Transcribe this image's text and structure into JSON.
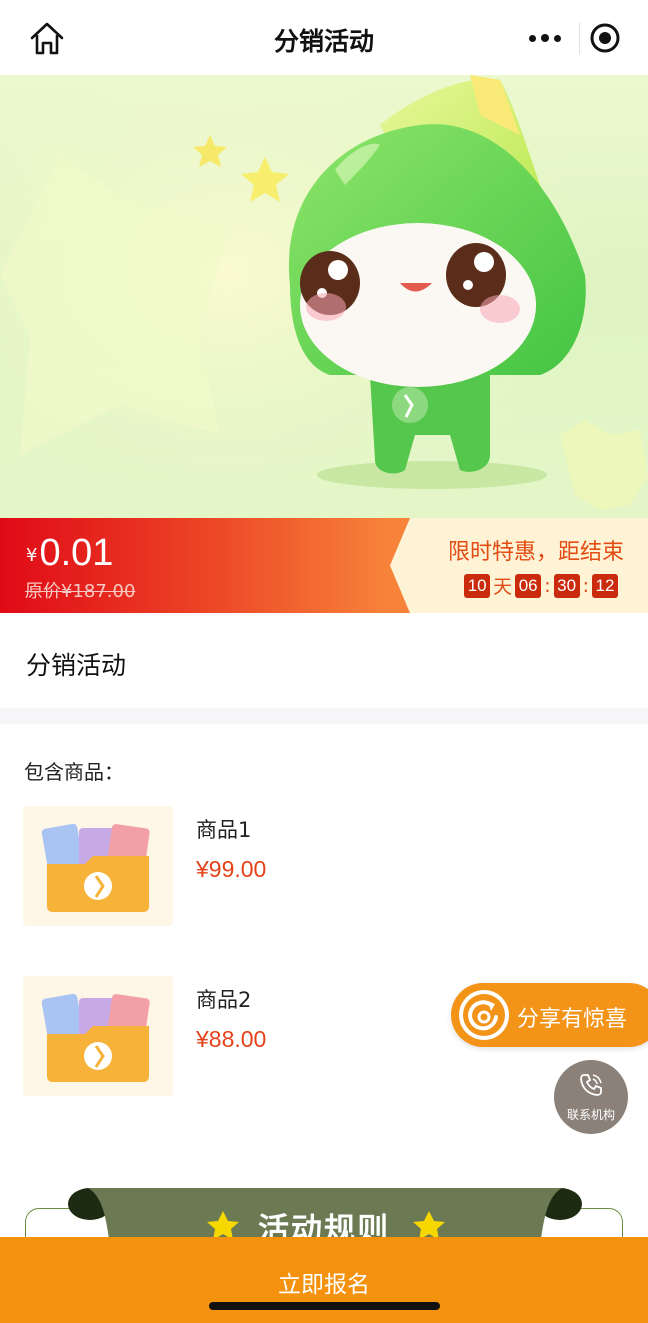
{
  "nav": {
    "title": "分销活动",
    "home_icon": "home-icon",
    "more_icon": "more-dots-icon",
    "close_icon": "target-circle-icon"
  },
  "hero": {
    "illustration": "green-mascot-banner"
  },
  "price": {
    "currency": "¥",
    "current": "0.01",
    "original": "原价¥187.00",
    "promo_text": "限时特惠，距结束",
    "countdown": {
      "days": "10",
      "day_unit": "天",
      "hours": "06",
      "minutes": "30",
      "seconds": "12",
      "sep": ":"
    }
  },
  "activity": {
    "title": "分销活动"
  },
  "products": {
    "heading": "包含商品：",
    "items": [
      {
        "name": "商品1",
        "price": "¥99.00",
        "thumb_icon": "folder-cards-icon"
      },
      {
        "name": "商品2",
        "price": "¥88.00",
        "thumb_icon": "folder-cards-icon"
      }
    ]
  },
  "floating": {
    "share_label": "分享有惊喜",
    "share_icon": "share-refresh-icon",
    "contact_label": "联系机构",
    "contact_icon": "phone-icon"
  },
  "rules": {
    "title": "活动规则",
    "star_icon": "star-icon"
  },
  "bottom": {
    "cta_label": "立即报名"
  },
  "colors": {
    "accent_orange": "#f4920e",
    "price_red": "#e3421a",
    "countdown_red": "#c92b0c",
    "ribbon_green": "#6b7a52"
  }
}
